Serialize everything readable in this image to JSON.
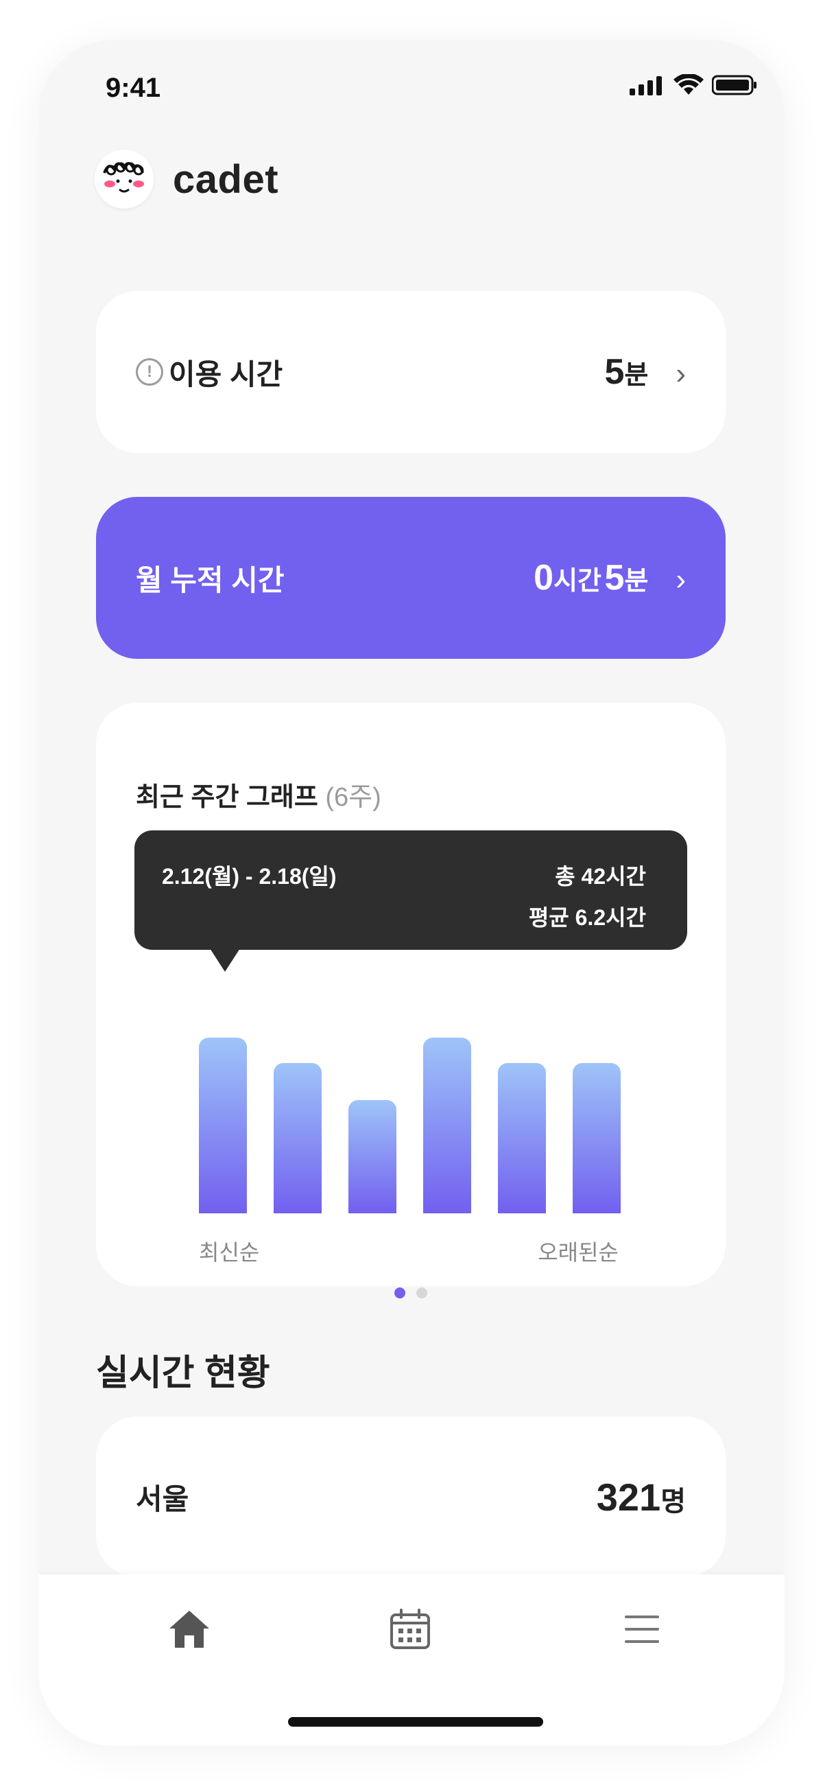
{
  "status": {
    "time": "9:41"
  },
  "header": {
    "app_name": "cadet"
  },
  "usage": {
    "label": "이용 시간",
    "value": "5",
    "unit": "분"
  },
  "monthly": {
    "label": "월 누적 시간",
    "hours": "0",
    "hours_unit": "시간",
    "minutes": "5",
    "minutes_unit": "분"
  },
  "graph": {
    "title": "최근 주간 그래프",
    "subtitle": "(6주)",
    "tooltip": {
      "range": "2.12(월) - 2.18(일)",
      "total": "총 42시간",
      "average": "평균 6.2시간"
    },
    "axis_left": "최신순",
    "axis_right": "오래된순",
    "pages": 2,
    "active_page": 0
  },
  "chart_data": {
    "type": "bar",
    "categories": [
      "1",
      "2",
      "3",
      "4",
      "5",
      "6"
    ],
    "values": [
      42,
      36,
      27,
      42,
      36,
      36
    ],
    "ylim": [
      0,
      42
    ],
    "gradient": [
      "#9ec4f8",
      "#7260ef"
    ]
  },
  "realtime": {
    "title": "실시간 현황",
    "city": "서울",
    "count": "321",
    "unit": "명"
  },
  "nav": {
    "icons": [
      "home-icon",
      "calendar-icon",
      "menu-icon"
    ]
  },
  "colors": {
    "accent": "#7260ef",
    "background": "#f6f6f6",
    "tooltip": "#2e2e2e"
  }
}
